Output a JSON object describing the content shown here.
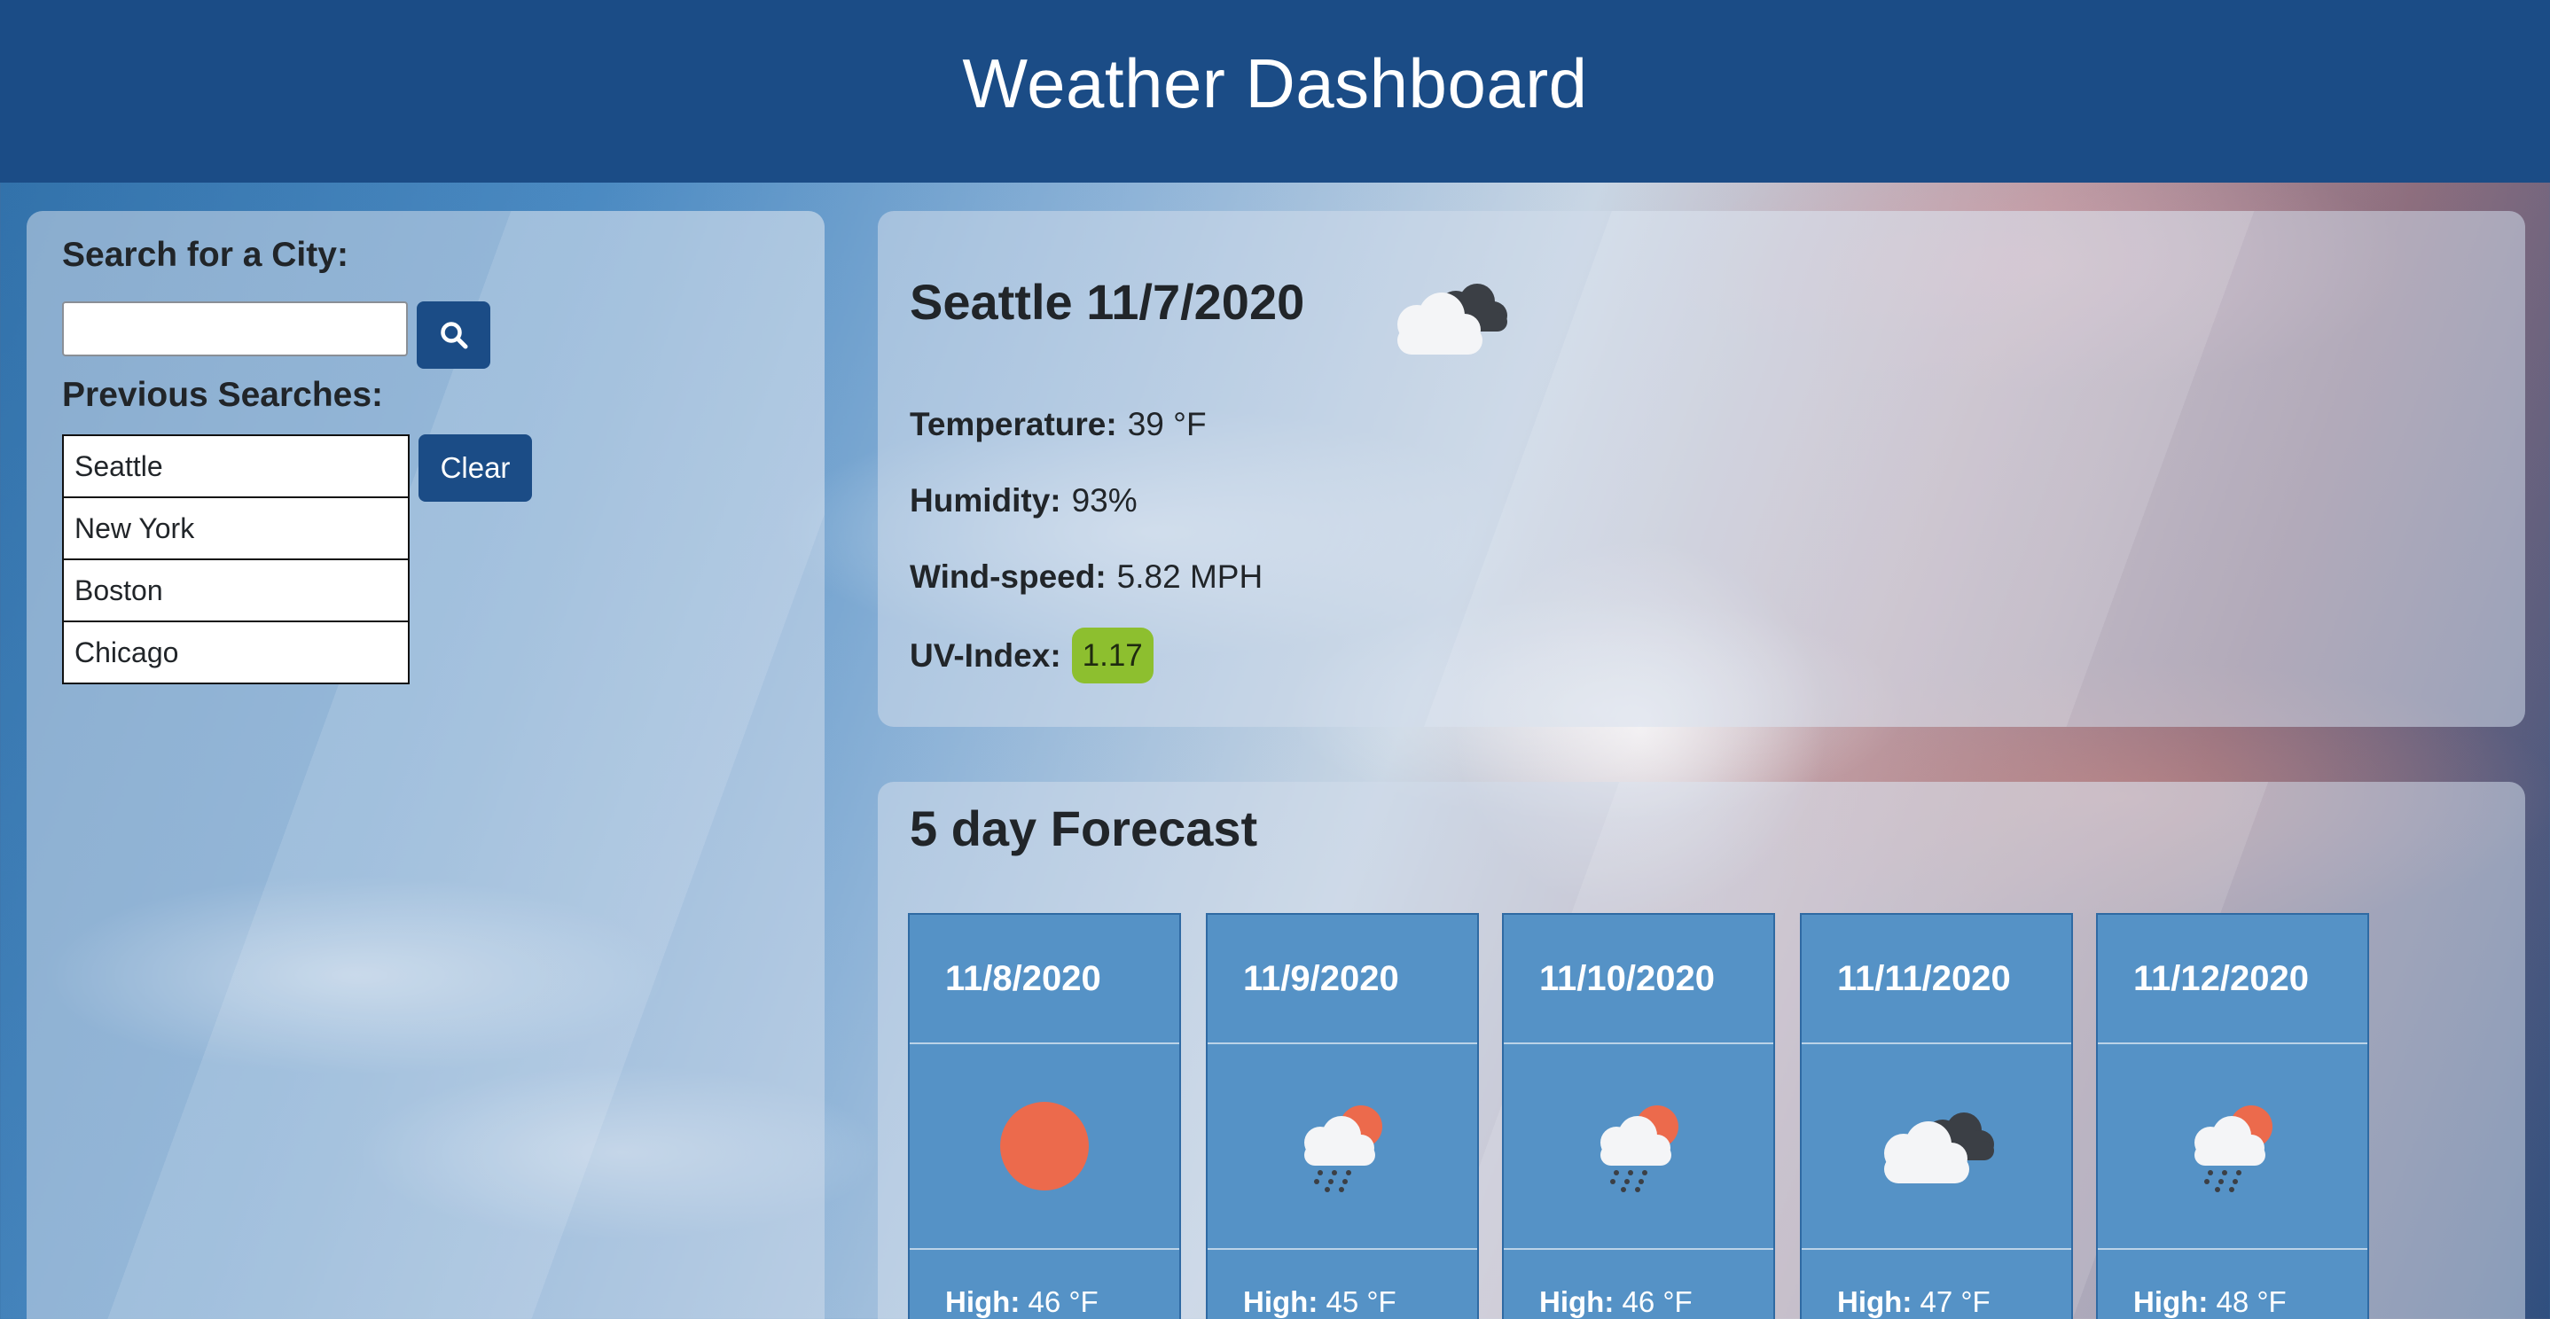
{
  "header": {
    "title": "Weather Dashboard"
  },
  "search": {
    "label": "Search for a City:",
    "input_value": "",
    "placeholder": "",
    "button_icon": "search-icon",
    "previous_label": "Previous Searches:",
    "clear_label": "Clear",
    "history": [
      "Seattle",
      "New York",
      "Boston",
      "Chicago"
    ]
  },
  "current": {
    "title": "Seattle 11/7/2020",
    "icon": "cloudy-icon",
    "temperature_label": "Temperature:",
    "temperature_value": "39 °F",
    "humidity_label": "Humidity:",
    "humidity_value": "93%",
    "wind_label": "Wind-speed:",
    "wind_value": "5.82 MPH",
    "uv_label": "UV-Index:",
    "uv_value": "1.17",
    "uv_color": "#8dbf2f"
  },
  "forecast": {
    "title": "5 day Forecast",
    "high_label": "High:",
    "days": [
      {
        "date": "11/8/2020",
        "icon": "sun-icon",
        "high": "46 °F"
      },
      {
        "date": "11/9/2020",
        "icon": "rain-sun-icon",
        "high": "45 °F"
      },
      {
        "date": "11/10/2020",
        "icon": "rain-sun-icon",
        "high": "46 °F"
      },
      {
        "date": "11/11/2020",
        "icon": "cloudy-icon",
        "high": "47 °F"
      },
      {
        "date": "11/12/2020",
        "icon": "rain-sun-icon",
        "high": "48 °F"
      }
    ]
  },
  "colors": {
    "header_bg": "#1b4c86",
    "button_bg": "#1b4c86",
    "card_bg": "#5592c6",
    "sun": "#ec6a4c"
  }
}
